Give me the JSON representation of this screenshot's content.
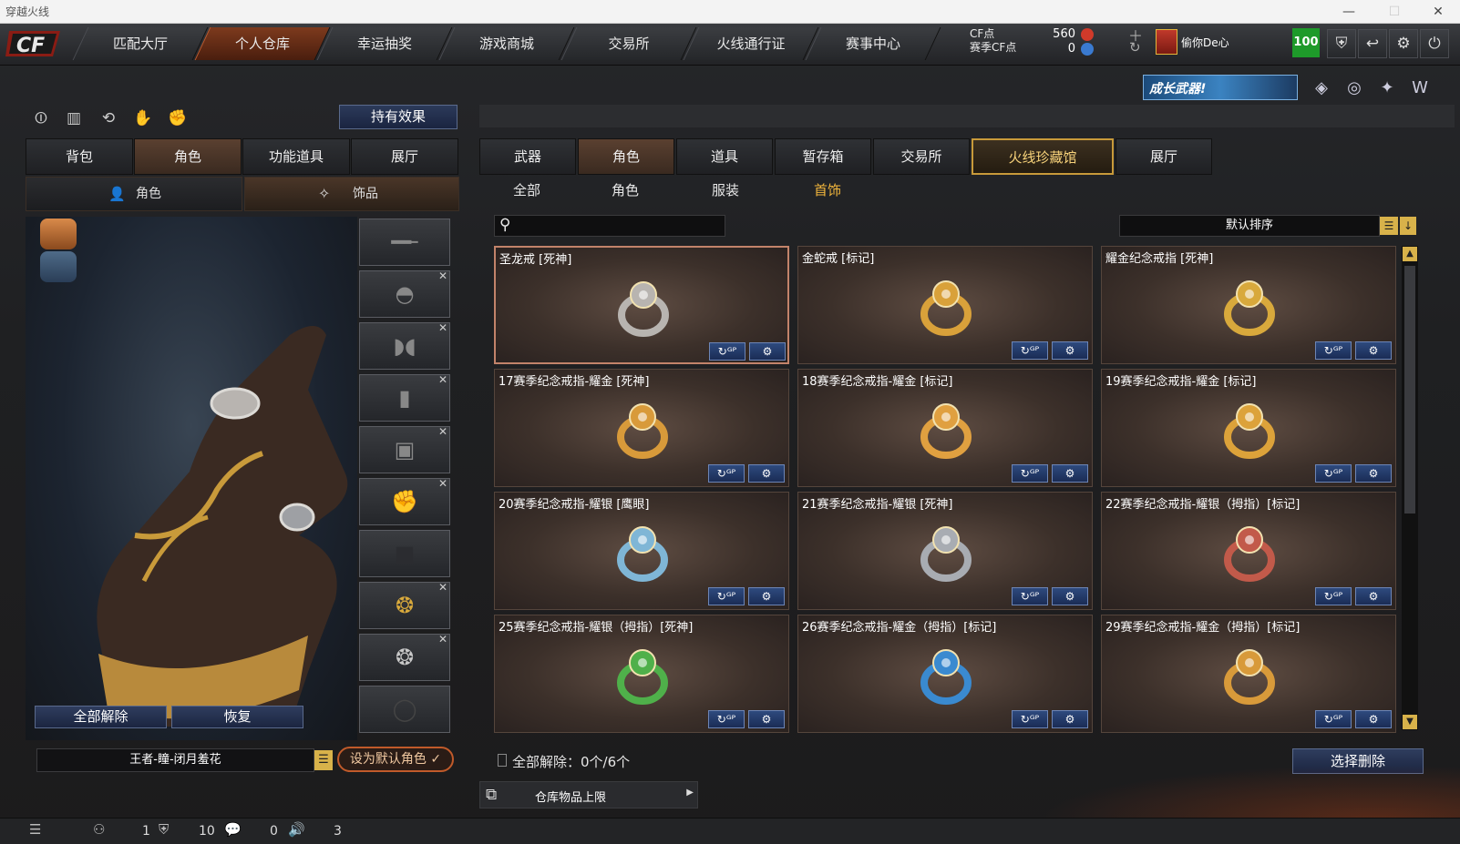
{
  "window": {
    "title": "穿越火线"
  },
  "nav": {
    "tabs": [
      {
        "label": "匹配大厅"
      },
      {
        "label": "个人仓库"
      },
      {
        "label": "幸运抽奖"
      },
      {
        "label": "游戏商城"
      },
      {
        "label": "交易所"
      },
      {
        "label": "火线通行证"
      },
      {
        "label": "赛事中心"
      }
    ],
    "active_tab": "个人仓库"
  },
  "currency": {
    "cf_label": "CF点",
    "season_label": "赛季CF点",
    "cf_value": "560",
    "season_value": "0",
    "add_icon": "plus-icon",
    "refresh_icon": "refresh-icon"
  },
  "user": {
    "name": "偷你De心",
    "level": "100"
  },
  "banner": {
    "text": "成长武器!"
  },
  "left": {
    "effect_button": "持有效果",
    "tabs": [
      {
        "label": "背包"
      },
      {
        "label": "角色"
      },
      {
        "label": "功能道具"
      },
      {
        "label": "展厅"
      }
    ],
    "subtabs": [
      {
        "label": "角色"
      },
      {
        "label": "饰品"
      }
    ],
    "slot_icons": [
      "sniper-rifle-icon",
      "helmet-icon",
      "goggles-icon",
      "radio-icon",
      "backpack-icon",
      "glove-icon",
      "empty-slot-icon",
      "dragon-ring-icon",
      "silver-ring-icon",
      "ring-slot-icon"
    ],
    "unequip_all": "全部解除",
    "restore": "恢复",
    "character_name": "王者-瞳-闭月羞花",
    "set_default": "设为默认角色"
  },
  "right": {
    "tabs": [
      {
        "label": "武器"
      },
      {
        "label": "角色"
      },
      {
        "label": "道具"
      },
      {
        "label": "暂存箱"
      },
      {
        "label": "交易所"
      },
      {
        "label": "火线珍藏馆"
      },
      {
        "label": "展厅"
      }
    ],
    "subtabs": [
      {
        "label": "全部"
      },
      {
        "label": "角色"
      },
      {
        "label": "服装"
      },
      {
        "label": "首饰"
      }
    ],
    "search_placeholder": "",
    "sort_label": "默认排序",
    "items": [
      {
        "name": "圣龙戒 [死神]",
        "color": "#b8b4b0"
      },
      {
        "name": "金蛇戒 [标记]",
        "color": "#d9a13a"
      },
      {
        "name": "耀金纪念戒指 [死神]",
        "color": "#d8a93c"
      },
      {
        "name": "17赛季纪念戒指-耀金 [死神]",
        "color": "#d89a3a"
      },
      {
        "name": "18赛季纪念戒指-耀金 [标记]",
        "color": "#e0a040"
      },
      {
        "name": "19赛季纪念戒指-耀金 [标记]",
        "color": "#dca23a"
      },
      {
        "name": "20赛季纪念戒指-耀银 [鹰眼]",
        "color": "#7fb6d6"
      },
      {
        "name": "21赛季纪念戒指-耀银  [死神]",
        "color": "#a8acb2"
      },
      {
        "name": "22赛季纪念戒指-耀银（拇指）[标记]",
        "color": "#c25a4a"
      },
      {
        "name": "25赛季纪念戒指-耀银（拇指）[死神]",
        "color": "#4fb04a"
      },
      {
        "name": "26赛季纪念戒指-耀金（拇指）[标记]",
        "color": "#3a8ad0"
      },
      {
        "name": "29赛季纪念戒指-耀金（拇指）[标记]",
        "color": "#d89a3a"
      }
    ],
    "bulk_label": "全部解除：0个/6个",
    "select_delete": "选择删除",
    "storage_label": "仓库物品上限"
  },
  "footer": {
    "values": [
      "1",
      "10",
      "0",
      "3"
    ]
  }
}
